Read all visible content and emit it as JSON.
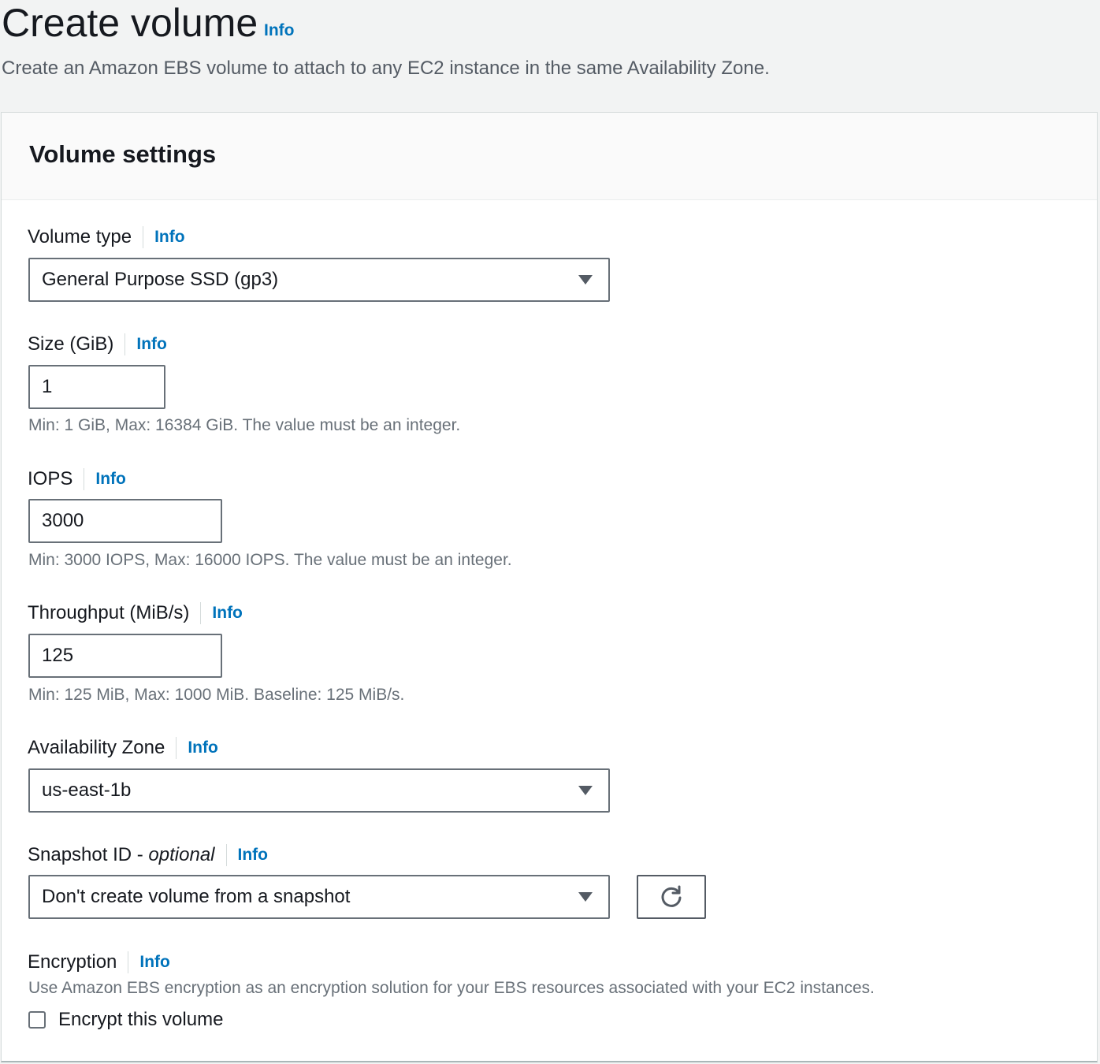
{
  "page": {
    "title": "Create volume",
    "title_info": "Info",
    "description": "Create an Amazon EBS volume to attach to any EC2 instance in the same Availability Zone."
  },
  "container": {
    "title": "Volume settings"
  },
  "fields": {
    "volume_type": {
      "label": "Volume type",
      "info": "Info",
      "value": "General Purpose SSD (gp3)"
    },
    "size": {
      "label": "Size (GiB)",
      "info": "Info",
      "value": "1",
      "hint": "Min: 1 GiB, Max: 16384 GiB. The value must be an integer."
    },
    "iops": {
      "label": "IOPS",
      "info": "Info",
      "value": "3000",
      "hint": "Min: 3000 IOPS, Max: 16000 IOPS. The value must be an integer."
    },
    "throughput": {
      "label": "Throughput (MiB/s)",
      "info": "Info",
      "value": "125",
      "hint": "Min: 125 MiB, Max: 1000 MiB. Baseline: 125 MiB/s."
    },
    "availability_zone": {
      "label": "Availability Zone",
      "info": "Info",
      "value": "us-east-1b"
    },
    "snapshot_id": {
      "label": "Snapshot ID - ",
      "label_optional": "optional",
      "info": "Info",
      "value": "Don't create volume from a snapshot"
    },
    "encryption": {
      "label": "Encryption",
      "info": "Info",
      "description": "Use Amazon EBS encryption as an encryption solution for your EBS resources associated with your EC2 instances.",
      "checkbox_label": "Encrypt this volume",
      "checked": false
    }
  },
  "icons": {
    "refresh": "refresh-icon",
    "caret": "caret-down-icon"
  },
  "colors": {
    "link": "#0073bb",
    "text": "#16191f",
    "secondary_text": "#687078",
    "page_bg": "#f2f3f3",
    "border": "#687078"
  }
}
